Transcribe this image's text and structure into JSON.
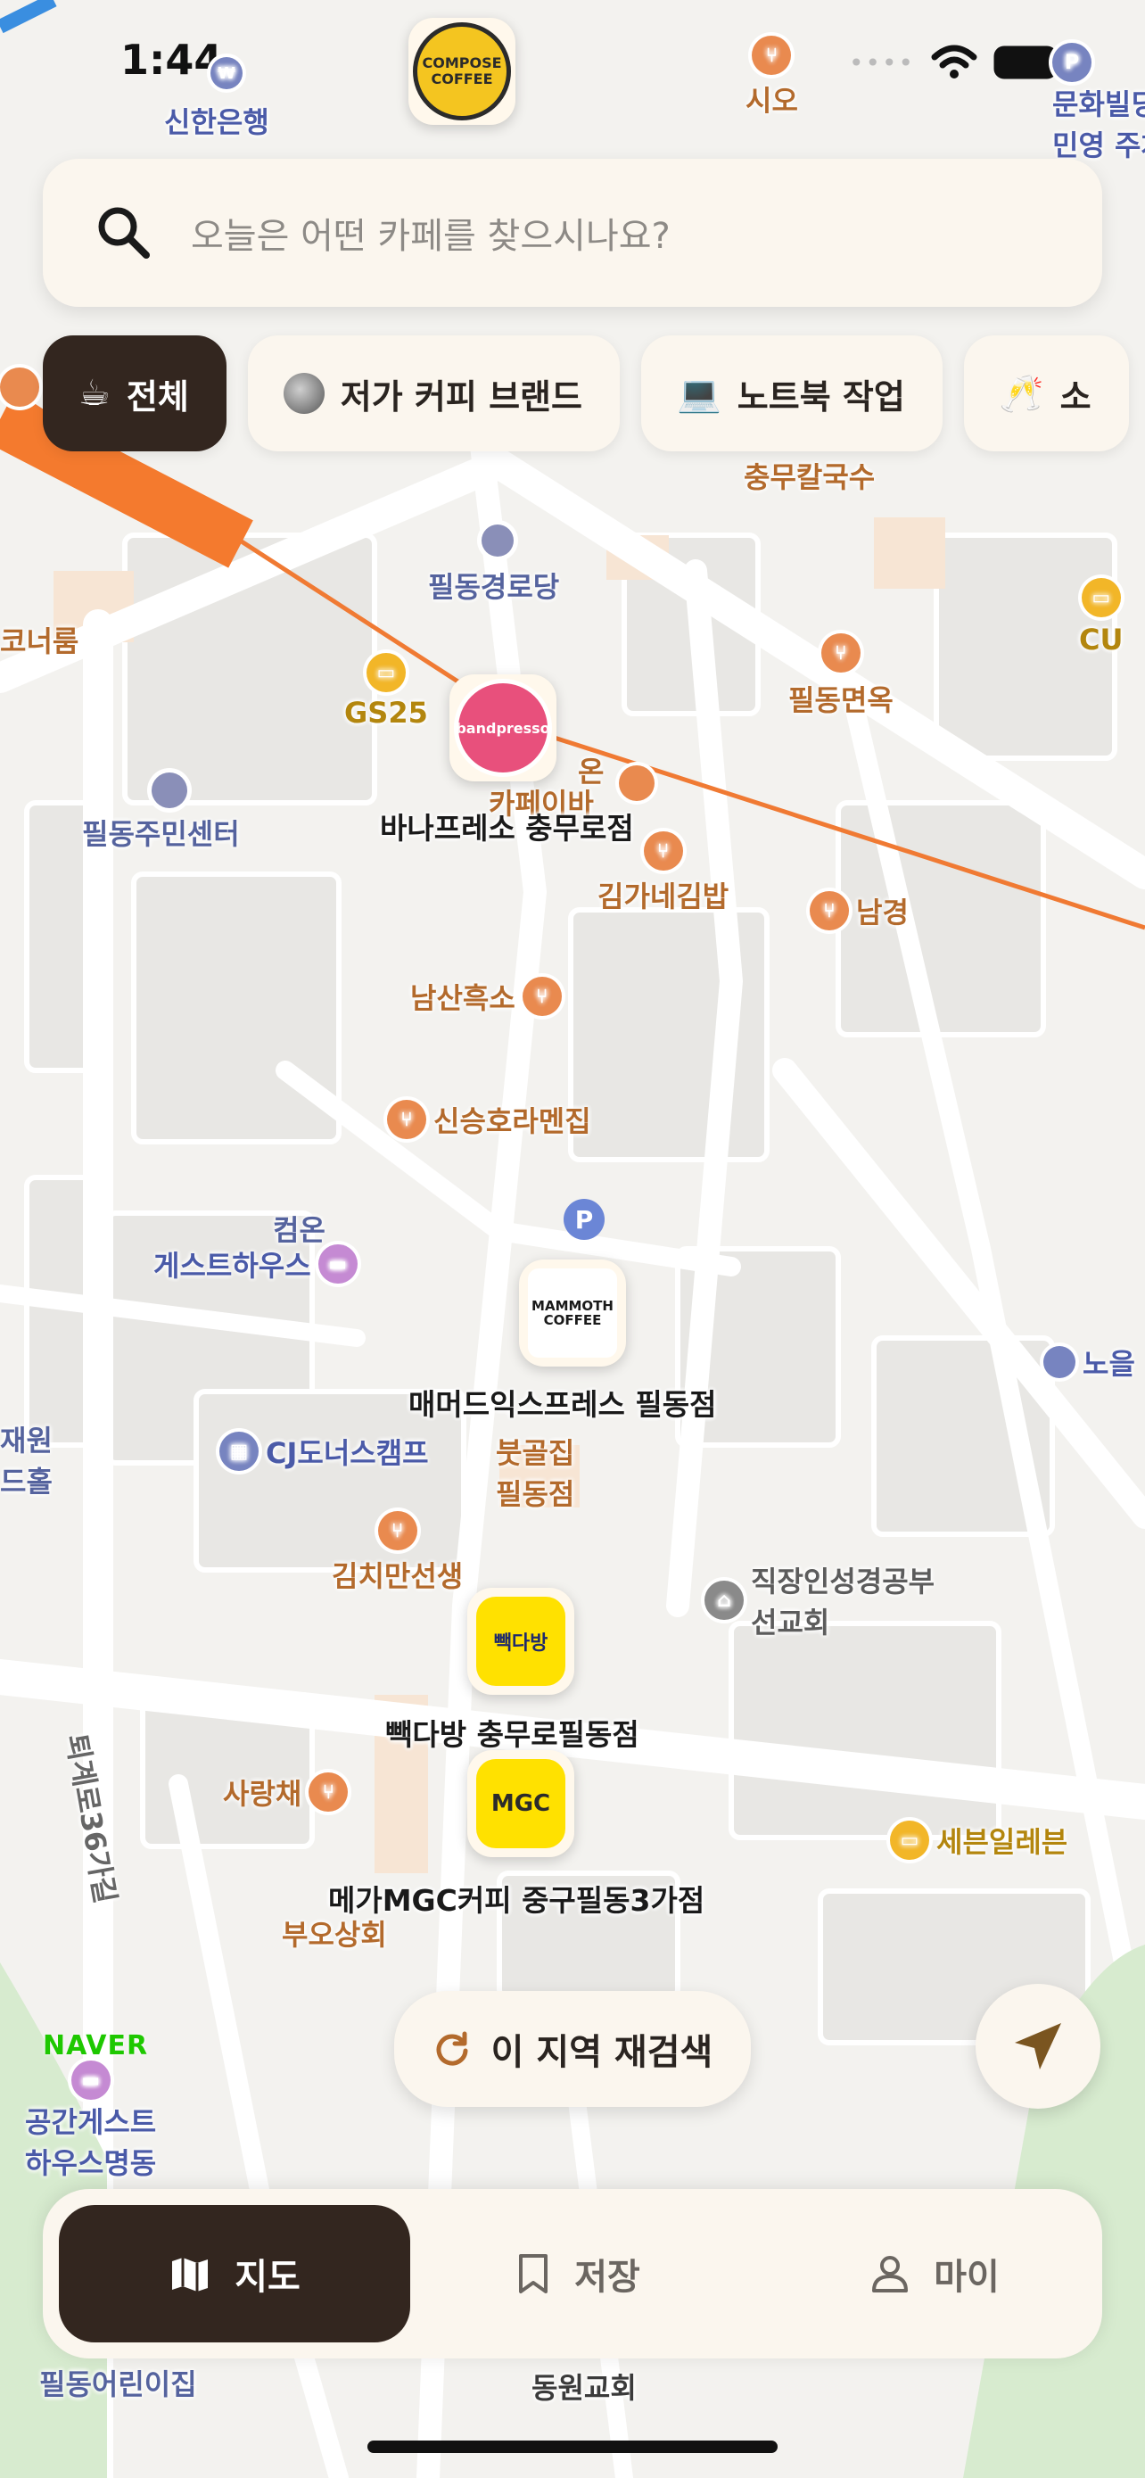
{
  "status_bar": {
    "time": "1:44"
  },
  "search": {
    "placeholder": "오늘은 어떤 카페를 찾으시나요?"
  },
  "chips": [
    {
      "label": "전체",
      "icon": "coffee-cup-icon",
      "active": true
    },
    {
      "label": "저가 커피 브랜드",
      "icon": "coin-icon",
      "active": false
    },
    {
      "label": "노트북 작업",
      "icon": "laptop-icon",
      "active": false
    },
    {
      "label": "소",
      "icon": "glasses-icon",
      "active": false
    }
  ],
  "cafes": [
    {
      "name": "COMPOSE COFFEE",
      "caption": "",
      "brand_color": "#f4c520"
    },
    {
      "name": "bandpresso",
      "caption": "바나프레소 충무로점",
      "brand_color": "#e8507c"
    },
    {
      "name": "MAMMOTH COFFEE",
      "caption": "매머드익스프레스 필동점",
      "brand_color": "#1a1a1a"
    },
    {
      "name": "빽다방",
      "caption": "빽다방 충무로필동점",
      "brand_color": "#ffe100"
    },
    {
      "name": "MGC",
      "caption": "메가MGC커피 중구필동3가점",
      "brand_color": "#ffe100"
    }
  ],
  "map_labels": {
    "shinhan": "신한은행",
    "sio": "시오",
    "munhwa": "문화빌딩",
    "minyoung": "민영 주차",
    "pildong_gyeongrodang": "필동경로당",
    "chungmu_kalguksu": "충무칼국수",
    "cu": "CU",
    "gs25": "GS25",
    "corner": "코너룸",
    "pildong_myeonok": "필동면옥",
    "community_center": "필동주민센터",
    "kimgane": "김가네김밥",
    "namgyeong": "남경",
    "namsan_heukso": "남산흑소",
    "shinseung": "신승호라멘집",
    "compass_guest_1": "컴온",
    "compass_guest_2": "게스트하우스",
    "cj": "CJ도너스캠프",
    "bukgoljip_1": "붓골집",
    "bukgoljip_2": "필동점",
    "kimchi": "김치만선생",
    "jikjang_1": "직장인성경공부",
    "jikjang_2": "선교회",
    "sarangchae": "사랑채",
    "seven": "세븐일레븐",
    "buo": "부오상회",
    "toegye": "퇴계로36가길",
    "gonggan_1": "공간게스트",
    "gonggan_2": "하우스명동",
    "pildong_kinder": "필동어린이집",
    "dongwon": "동원교회",
    "jaewon_1": "재원",
    "jaewon_2": "드홀",
    "noeul": "노을",
    "kafe_ibar": "카페이바",
    "on": "온"
  },
  "buttons": {
    "research": "이 지역 재검색"
  },
  "tabs": [
    {
      "label": "지도",
      "icon": "map-icon",
      "active": true
    },
    {
      "label": "저장",
      "icon": "bookmark-icon",
      "active": false
    },
    {
      "label": "마이",
      "icon": "person-icon",
      "active": false
    }
  ],
  "attribution": "NAVER",
  "colors": {
    "accent_dark": "#33261f",
    "surface": "#fbf6ee",
    "route": "#f07a33"
  }
}
